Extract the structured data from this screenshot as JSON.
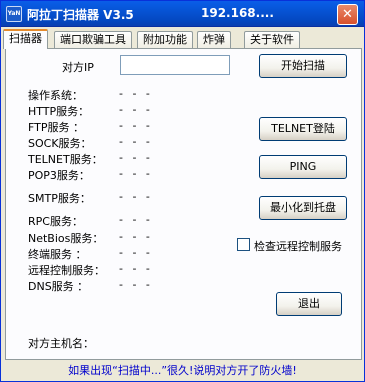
{
  "window": {
    "title": "阿拉丁扫描器 V3.5",
    "title_ip": "192.168....",
    "close_label": "✕",
    "app_icon_text": "YaN"
  },
  "tabs": [
    {
      "label": "扫描器",
      "active": true
    },
    {
      "label": "端口欺骗工具",
      "active": false
    },
    {
      "label": "附加功能",
      "active": false
    },
    {
      "label": "炸弹",
      "active": false
    },
    {
      "label": "关于软件",
      "active": false
    }
  ],
  "target": {
    "label": "对方IP",
    "value": ""
  },
  "info_rows": [
    {
      "label": "操作系统：",
      "value": "- - -"
    },
    {
      "label": "HTTP服务：",
      "value": "- - -"
    },
    {
      "label": "FTP服务  ：",
      "value": "- - -"
    },
    {
      "label": "SOCK服务：",
      "value": "- - -"
    },
    {
      "label": "TELNET服务：",
      "value": "- - -"
    },
    {
      "label": "POP3服务：",
      "value": "- - -"
    },
    {
      "label": "SMTP服务：",
      "value": "- - -"
    },
    {
      "label": "RPC服务：",
      "value": "- - -"
    },
    {
      "label": "NetBios服务：",
      "value": "- - -"
    },
    {
      "label": "终端服务  ：",
      "value": "- - -"
    },
    {
      "label": "远程控制服务：",
      "value": "- - -"
    },
    {
      "label": "DNS服务  ：",
      "value": "- - -"
    }
  ],
  "buttons": {
    "start_scan": "开始扫描",
    "telnet": "TELNET登陆",
    "ping": "PING",
    "minimize_tray": "最小化到托盘",
    "exit": "退出"
  },
  "check_remote": {
    "label": "检查远程控制服务",
    "checked": false
  },
  "host_name": {
    "label": "对方主机名："
  },
  "status_text": "如果出现“扫描中...”很久!说明对方开了防火墙!"
}
